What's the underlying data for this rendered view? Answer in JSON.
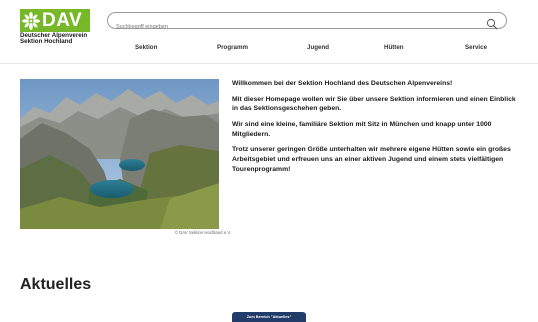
{
  "header": {
    "logo": {
      "wordmark": "DAV",
      "line1": "Deutscher Alpenverein",
      "line2": "Sektion Hochland",
      "brand_color": "#76b82a"
    },
    "search": {
      "placeholder": "Suchbegriff eingeben",
      "icon": "search-icon"
    },
    "nav": [
      "Sektion",
      "Programm",
      "Jugend",
      "Hütten",
      "Service"
    ]
  },
  "hero": {
    "image_icon": "mountain-lake-photo",
    "credit": "© DAV Sektion Hochland e.V.",
    "paragraphs": [
      "Willkommen bei der Sektion Hochland des Deutschen Alpenvereins!",
      "Mit dieser Homepage wollen wir Sie über unsere Sektion informieren und einen Einblick in das Sektionsgeschehen geben.",
      "Wir sind eine kleine, familiäre Sektion mit Sitz in München und knapp unter 1000 Mitgliedern.",
      "Trotz unserer geringen Größe unterhalten wir mehrere eigene Hütten sowie ein großes Arbeitsgebiet und erfreuen uns an einer aktiven Jugend und einem stets vielfältigen Tourenprogramm!"
    ]
  },
  "news": {
    "heading": "Aktuelles",
    "button_label": "Zum Bereich \"Aktuelles\"",
    "button_color": "#213c68"
  }
}
